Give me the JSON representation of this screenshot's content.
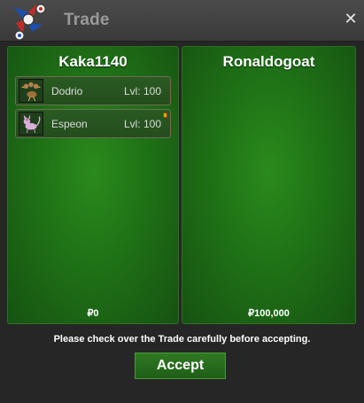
{
  "window": {
    "title": "Trade",
    "close_symbol": "✕"
  },
  "left_player": {
    "name": "Kaka1140",
    "pokemon": [
      {
        "name": "Dodrio",
        "level": "Lvl: 100",
        "icon": "dodrio-sprite",
        "held_item": false
      },
      {
        "name": "Espeon",
        "level": "Lvl: 100",
        "icon": "espeon-sprite",
        "held_item": true
      }
    ],
    "money": "₽0"
  },
  "right_player": {
    "name": "Ronaldogoat",
    "pokemon": [],
    "money": "₽100,000"
  },
  "notice": "Please check over the Trade carefully before accepting.",
  "accept_label": "Accept",
  "colors": {
    "panel_green": "#1f7116",
    "title_bar": "#444444",
    "held_item": "#e0a81a"
  }
}
